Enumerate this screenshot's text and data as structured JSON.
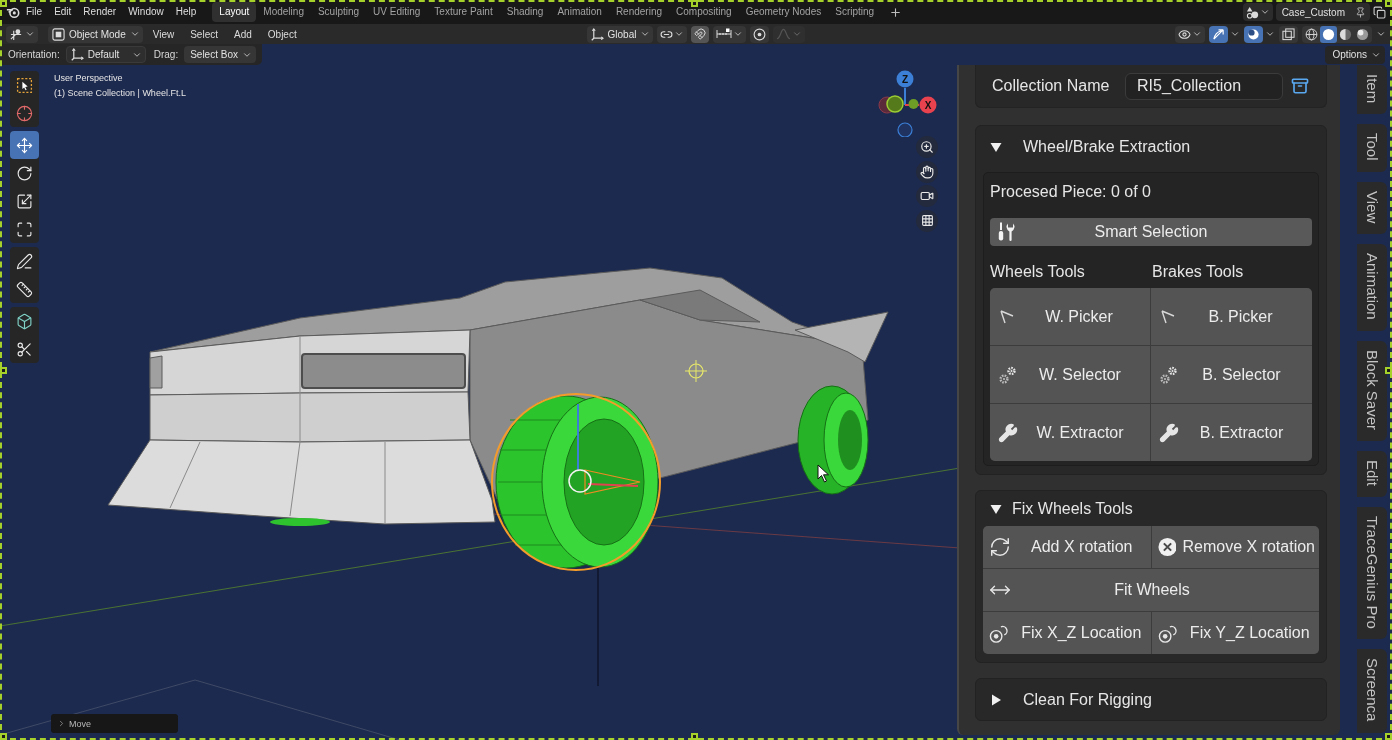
{
  "top_bar": {
    "menus": [
      "File",
      "Edit",
      "Render",
      "Window",
      "Help"
    ],
    "workspaces": [
      {
        "label": "Layout",
        "selected": true
      },
      {
        "label": "Modeling",
        "selected": false
      },
      {
        "label": "Sculpting",
        "selected": false
      },
      {
        "label": "UV Editing",
        "selected": false
      },
      {
        "label": "Texture Paint",
        "selected": false
      },
      {
        "label": "Shading",
        "selected": false
      },
      {
        "label": "Animation",
        "selected": false
      },
      {
        "label": "Rendering",
        "selected": false
      },
      {
        "label": "Compositing",
        "selected": false
      },
      {
        "label": "Geometry Nodes",
        "selected": false
      },
      {
        "label": "Scripting",
        "selected": false
      }
    ],
    "scene": "Case_Custom"
  },
  "header": {
    "mode": "Object Mode",
    "menus": [
      "View",
      "Select",
      "Add",
      "Object"
    ],
    "orientation": "Global",
    "toggles": [
      {
        "kind": "gizmos",
        "on": true
      },
      {
        "kind": "overlays",
        "on": true
      },
      {
        "kind": "xray",
        "on": false
      }
    ],
    "shading": [
      {
        "kind": "wireframe",
        "selected": false
      },
      {
        "kind": "solid",
        "selected": true
      },
      {
        "kind": "material",
        "selected": false
      },
      {
        "kind": "rendered",
        "selected": false
      }
    ]
  },
  "tool_settings": {
    "orientation_label": "Orientation:",
    "orientation": "Default",
    "drag_label": "Drag:",
    "drag": "Select Box",
    "options": "Options"
  },
  "toolbar": [
    [
      {
        "kind": "select_box",
        "selected": false
      },
      {
        "kind": "cursor",
        "selected": false
      }
    ],
    [
      {
        "kind": "move",
        "selected": true
      },
      {
        "kind": "rotate",
        "selected": false
      },
      {
        "kind": "scale",
        "selected": false
      },
      {
        "kind": "transform",
        "selected": false
      }
    ],
    [
      {
        "kind": "annotate",
        "selected": false
      },
      {
        "kind": "measure",
        "selected": false
      }
    ],
    [
      {
        "kind": "add_cube",
        "selected": false
      },
      {
        "kind": "knife",
        "selected": false
      }
    ]
  ],
  "viewport": {
    "view_name": "User Perspective",
    "object_info": "(1) Scene Collection | Wheel.Ft.L",
    "gizmo_axes": [
      "Z",
      "X"
    ],
    "last_operator": "Move"
  },
  "sidebar": {
    "collection": {
      "label": "Collection Name",
      "value": "RI5_Collection"
    },
    "panels": [
      {
        "kind": "extraction",
        "title": "Wheel/Brake Extraction",
        "expanded": true,
        "status": "Procesed Piece: 0 of 0",
        "action": "Smart Selection",
        "groups": [
          {
            "heading": "Wheels Tools",
            "buttons": [
              {
                "kind": "picker",
                "label": "W. Picker"
              },
              {
                "kind": "selector",
                "label": "W. Selector"
              },
              {
                "kind": "extractor",
                "label": "W. Extractor"
              }
            ]
          },
          {
            "heading": "Brakes Tools",
            "buttons": [
              {
                "kind": "picker",
                "label": "B. Picker"
              },
              {
                "kind": "selector",
                "label": "B. Selector"
              },
              {
                "kind": "extractor",
                "label": "B. Extractor"
              }
            ]
          }
        ]
      },
      {
        "kind": "button_rows",
        "title": "Fix Wheels Tools",
        "expanded": true,
        "rows": [
          [
            {
              "kind": "rotate",
              "label": "Add X rotation"
            },
            {
              "kind": "remove",
              "label": "Remove X rotation"
            }
          ],
          [
            {
              "kind": "fit",
              "label": "Fit Wheels"
            }
          ],
          [
            {
              "kind": "pivot",
              "label": "Fix X_Z Location"
            },
            {
              "kind": "pivot",
              "label": "Fix Y_Z Location"
            }
          ]
        ]
      },
      {
        "kind": "button_rows",
        "title": "Clean For Rigging",
        "expanded": false
      }
    ],
    "tabs": [
      {
        "label": "Item",
        "selected": false
      },
      {
        "label": "Tool",
        "selected": false
      },
      {
        "label": "View",
        "selected": false
      },
      {
        "label": "Animation",
        "selected": false
      },
      {
        "label": "Block Saver",
        "selected": false
      },
      {
        "label": "Edit",
        "selected": false
      },
      {
        "label": "TraceGenius Pro",
        "selected": false
      },
      {
        "label": "Screenca",
        "selected": false
      }
    ]
  }
}
